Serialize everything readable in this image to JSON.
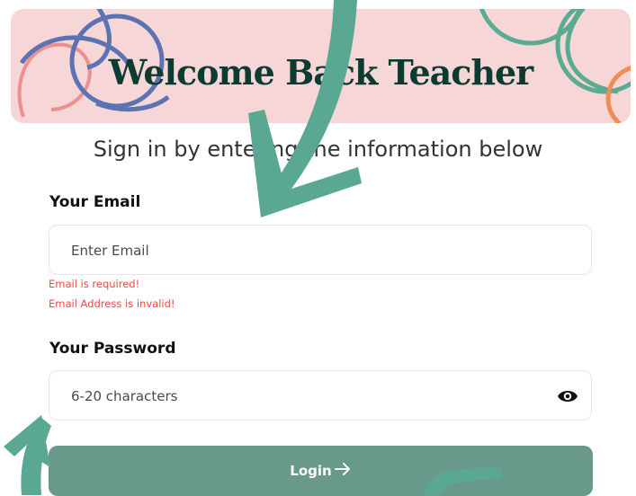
{
  "banner": {
    "title": "Welcome Back Teacher"
  },
  "subtitle": "Sign in by entering the information below",
  "form": {
    "email": {
      "label": "Your Email",
      "placeholder": "Enter Email",
      "value": "",
      "errors": [
        "Email is required!",
        "Email Address is invalid!"
      ]
    },
    "password": {
      "label": "Your Password",
      "placeholder": "6-20 characters",
      "value": "",
      "toggle_icon": "eye-icon"
    },
    "login": {
      "label": "Login",
      "icon": "arrow-right-icon"
    }
  },
  "colors": {
    "banner_bg": "#f6d6d6",
    "title": "#0c3b31",
    "button": "#69998a",
    "error": "#ea4b42",
    "arrow": "#5aa894"
  }
}
